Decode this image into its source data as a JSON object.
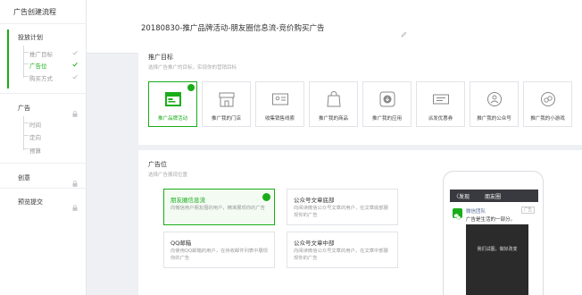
{
  "sidebar": {
    "title": "广告创建流程",
    "sections": [
      {
        "label": "投放计划",
        "items": [
          {
            "label": "推广目标",
            "state": "done"
          },
          {
            "label": "广告位",
            "state": "active"
          },
          {
            "label": "购买方式",
            "state": "done"
          }
        ]
      },
      {
        "label": "广告",
        "items": [
          {
            "label": "时间"
          },
          {
            "label": "定向"
          },
          {
            "label": "预算"
          }
        ]
      },
      {
        "label": "创意"
      },
      {
        "label": "预览提交"
      }
    ]
  },
  "header": {
    "title": "20180830-推广品牌活动-朋友圈信息流-竞价购买广告"
  },
  "promotion_goal": {
    "title": "推广目标",
    "subtitle": "选择广告推广的目标，实现你的营销目标",
    "options": [
      {
        "label": "推广品牌活动",
        "selected": true
      },
      {
        "label": "推广我的门店"
      },
      {
        "label": "收集销售线索"
      },
      {
        "label": "推广我的商品"
      },
      {
        "label": "推广我的应用"
      },
      {
        "label": "派发优惠券"
      },
      {
        "label": "推广我的公众号"
      },
      {
        "label": "推广我的小游戏"
      }
    ]
  },
  "ad_position": {
    "title": "广告位",
    "subtitle": "选择广告展现位置",
    "options": [
      {
        "title": "朋友圈信息流",
        "desc": "向微信用户朋友圈的用户，精准展现你的广告",
        "selected": true
      },
      {
        "title": "公众号文章底部",
        "desc": "向阅读微信公众号文章的用户，在文章底部展现你的广告"
      },
      {
        "title": "QQ邮箱",
        "desc": "向使用QQ邮箱的用户，在待收邮件列表中展现你的广告"
      },
      {
        "title": "公众号文章中部",
        "desc": "向阅读微信公众号文章的用户，在文章中部展现你的广告"
      }
    ]
  },
  "preview": {
    "back": "〈发现",
    "title": "朋友圈",
    "ad_name": "微信团队",
    "ad_tag": "广告",
    "ad_text": "广告是生活的一部分。",
    "image_text": "我们试图，做好改变"
  },
  "colors": {
    "accent": "#1aad19",
    "phone_bar": "#393a3f",
    "link": "#576b95"
  }
}
